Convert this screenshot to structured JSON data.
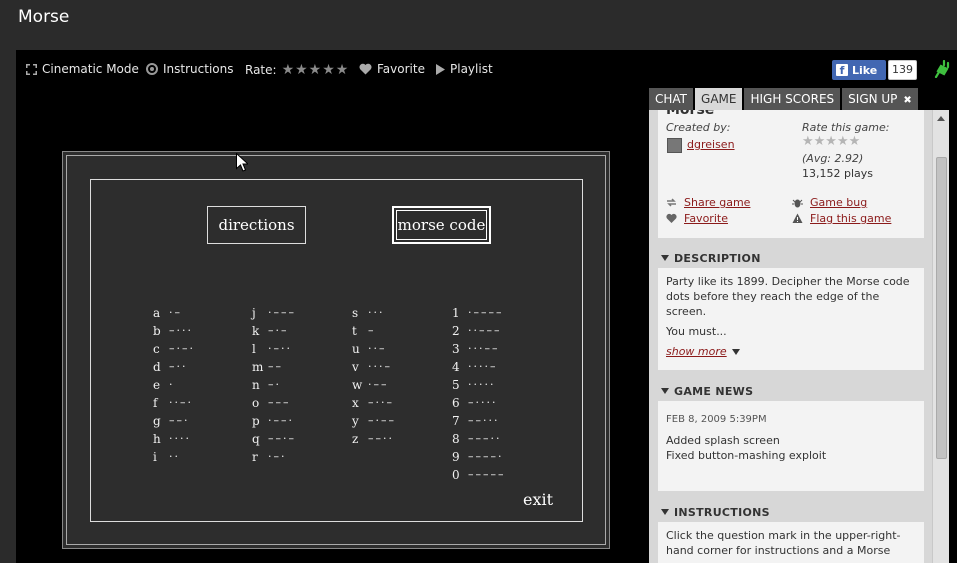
{
  "page": {
    "title": "Morse"
  },
  "toolbar": {
    "cinematic": "Cinematic Mode",
    "instructions": "Instructions",
    "rate_label": "Rate:",
    "stars": "★★★★★",
    "favorite": "Favorite",
    "playlist": "Playlist",
    "fb_like": "Like",
    "fb_count": "139"
  },
  "game": {
    "directions": "directions",
    "morse_code": "morse code",
    "exit": "exit",
    "columns": [
      [
        [
          "a",
          "·–"
        ],
        [
          "b",
          "–···"
        ],
        [
          "c",
          "–·–·"
        ],
        [
          "d",
          "–··"
        ],
        [
          "e",
          "·"
        ],
        [
          "f",
          "··–·"
        ],
        [
          "g",
          "––·"
        ],
        [
          "h",
          "····"
        ],
        [
          "i",
          "··"
        ]
      ],
      [
        [
          "j",
          "·–––"
        ],
        [
          "k",
          "–·–"
        ],
        [
          "l",
          "·–··"
        ],
        [
          "m",
          "––"
        ],
        [
          "n",
          "–·"
        ],
        [
          "o",
          "–––"
        ],
        [
          "p",
          "·––·"
        ],
        [
          "q",
          "––·–"
        ],
        [
          "r",
          "·–·"
        ]
      ],
      [
        [
          "s",
          "···"
        ],
        [
          "t",
          "–"
        ],
        [
          "u",
          "··–"
        ],
        [
          "v",
          "···–"
        ],
        [
          "w",
          "·––"
        ],
        [
          "x",
          "–··–"
        ],
        [
          "y",
          "–·––"
        ],
        [
          "z",
          "––··"
        ]
      ],
      [
        [
          "1",
          "·––––"
        ],
        [
          "2",
          "··–––"
        ],
        [
          "3",
          "···––"
        ],
        [
          "4",
          "····–"
        ],
        [
          "5",
          "·····"
        ],
        [
          "6",
          "–····"
        ],
        [
          "7",
          "––···"
        ],
        [
          "8",
          "–––··"
        ],
        [
          "9",
          "––––·"
        ],
        [
          "0",
          "–––––"
        ]
      ]
    ]
  },
  "tabs": [
    "CHAT",
    "GAME",
    "HIGH SCORES",
    "SIGN UP"
  ],
  "info": {
    "title_fragment": "Morse",
    "created_by": "Created by:",
    "author": "dgreisen",
    "rate_this": "Rate this game:",
    "rate_stars": "★★★★★",
    "avg": "(Avg: 2.92)",
    "plays": "13,152 plays",
    "share": "Share game",
    "favorite": "Favorite",
    "bug": "Game bug",
    "flag": "Flag this game"
  },
  "description": {
    "heading": "DESCRIPTION",
    "text": "Party like its 1899. Decipher the Morse code dots before they reach the edge of the screen.",
    "more": "You must...",
    "show_more": "show more"
  },
  "news": {
    "heading": "GAME NEWS",
    "date": "FEB 8, 2009 5:39PM",
    "line1": "Added splash screen",
    "line2": "Fixed button-mashing exploit"
  },
  "instructions": {
    "heading": "INSTRUCTIONS",
    "text": "Click the question mark in the upper-right-hand corner for instructions and a Morse"
  },
  "colors": {
    "link": "#8b1a1a",
    "fb": "#4267b2",
    "plug": "#3fbf3f"
  }
}
